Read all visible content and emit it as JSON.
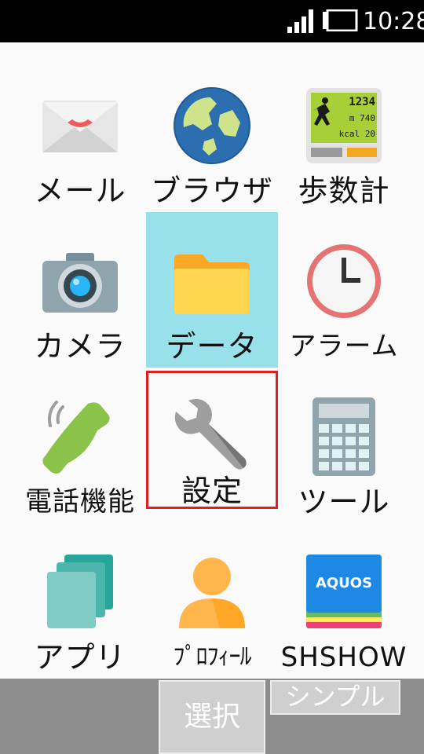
{
  "status": {
    "time": "10:28"
  },
  "apps": [
    {
      "id": "mail",
      "label": "メール",
      "icon": "mail-envelope-icon"
    },
    {
      "id": "browser",
      "label": "ブラウザ",
      "icon": "globe-icon"
    },
    {
      "id": "pedometer",
      "label": "歩数計",
      "icon": "pedometer-icon",
      "display": {
        "steps": "1234",
        "distance": "m 740",
        "kcal": "kcal 20"
      }
    },
    {
      "id": "camera",
      "label": "カメラ",
      "icon": "camera-icon"
    },
    {
      "id": "data",
      "label": "データ",
      "icon": "folder-icon"
    },
    {
      "id": "alarm",
      "label": "アラーム",
      "icon": "clock-icon"
    },
    {
      "id": "phone",
      "label": "電話機能",
      "icon": "phone-icon"
    },
    {
      "id": "settings",
      "label": "設定",
      "icon": "wrench-icon"
    },
    {
      "id": "tools",
      "label": "ツール",
      "icon": "calculator-icon"
    },
    {
      "id": "apps",
      "label": "アプリ",
      "icon": "app-cards-icon"
    },
    {
      "id": "profile",
      "label": "ﾌﾟﾛﾌｨｰﾙ",
      "icon": "person-icon"
    },
    {
      "id": "shshow",
      "label": "SHSHOW",
      "icon": "aquos-icon",
      "badge": "AQUOS"
    }
  ],
  "softkeys": {
    "center": "選択",
    "right": "シンプル"
  }
}
